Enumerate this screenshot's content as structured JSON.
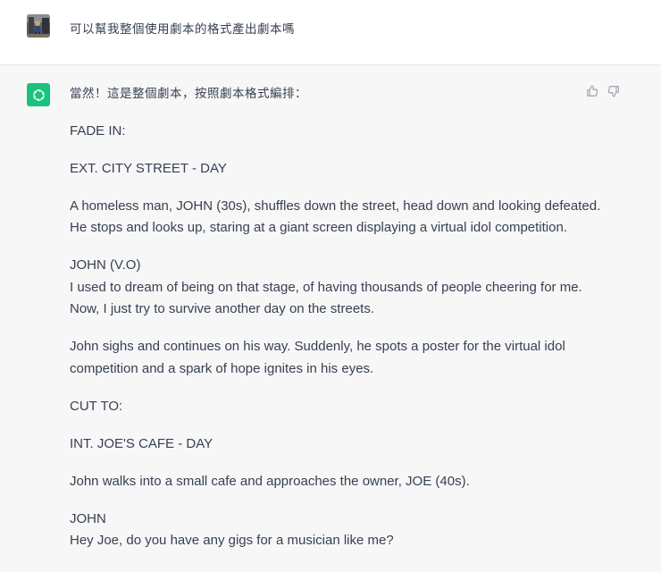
{
  "user_message": {
    "text": "可以幫我整個使用劇本的格式產出劇本嗎"
  },
  "assistant_message": {
    "intro": "當然！這是整個劇本，按照劇本格式編排：",
    "paragraphs": [
      "FADE IN:",
      "EXT. CITY STREET - DAY",
      "A homeless man, JOHN (30s), shuffles down the street, head down and looking defeated. He stops and looks up, staring at a giant screen displaying a virtual idol competition.",
      {
        "speaker": "JOHN (V.O)",
        "line": "I used to dream of being on that stage, of having thousands of people cheering for me. Now, I just try to survive another day on the streets."
      },
      "John sighs and continues on his way. Suddenly, he spots a poster for the virtual idol competition and a spark of hope ignites in his eyes.",
      "CUT TO:",
      "INT. JOE'S CAFE - DAY",
      "John walks into a small cafe and approaches the owner, JOE (40s).",
      {
        "speaker": "JOHN",
        "line": "Hey Joe, do you have any gigs for a musician like me?"
      }
    ]
  },
  "icons": {
    "user_avatar": "user-photo-avatar",
    "assistant_avatar": "openai-logo-icon",
    "thumbs_up": "thumbs-up-icon",
    "thumbs_down": "thumbs-down-icon"
  },
  "colors": {
    "assistant_bg": "#f7f7f8",
    "avatar_green": "#19c37d",
    "text": "#374151",
    "icon_gray": "#9ca3af"
  }
}
